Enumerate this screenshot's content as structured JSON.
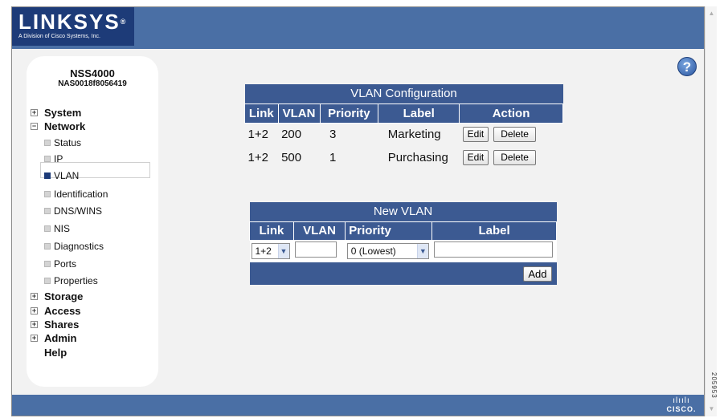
{
  "brand": {
    "name": "LINKSYS",
    "registered": "®",
    "tagline": "A Division of Cisco Systems, Inc.",
    "footer_logo": "CISCO."
  },
  "help_button": "?",
  "device": {
    "model": "NSS4000",
    "id": "NAS0018f8056419"
  },
  "sidebar": {
    "items": [
      {
        "label": "System",
        "type": "section",
        "toggle": "+"
      },
      {
        "label": "Network",
        "type": "section",
        "toggle": "−"
      },
      {
        "label": "Status",
        "type": "sub"
      },
      {
        "label": "IP",
        "type": "sub"
      },
      {
        "label": "VLAN",
        "type": "sub",
        "selected": true
      },
      {
        "label": "Identification",
        "type": "sub"
      },
      {
        "label": "DNS/WINS",
        "type": "sub"
      },
      {
        "label": "NIS",
        "type": "sub"
      },
      {
        "label": "Diagnostics",
        "type": "sub"
      },
      {
        "label": "Ports",
        "type": "sub"
      },
      {
        "label": "Properties",
        "type": "sub"
      },
      {
        "label": "Storage",
        "type": "section",
        "toggle": "+"
      },
      {
        "label": "Access",
        "type": "section",
        "toggle": "+"
      },
      {
        "label": "Shares",
        "type": "section",
        "toggle": "+"
      },
      {
        "label": "Admin",
        "type": "section",
        "toggle": "+"
      },
      {
        "label": "Help",
        "type": "section"
      }
    ]
  },
  "vlan_config": {
    "title": "VLAN Configuration",
    "headers": [
      "Link",
      "VLAN",
      "Priority",
      "Label",
      "Action"
    ],
    "rows": [
      {
        "link": "1+2",
        "vlan": "200",
        "priority": "3",
        "label": "Marketing"
      },
      {
        "link": "1+2",
        "vlan": "500",
        "priority": "1",
        "label": "Purchasing"
      }
    ],
    "edit_label": "Edit",
    "delete_label": "Delete"
  },
  "new_vlan": {
    "title": "New VLAN",
    "headers": [
      "Link",
      "VLAN",
      "Priority",
      "Label"
    ],
    "link_value": "1+2",
    "vlan_value": "",
    "priority_value": "0 (Lowest)",
    "label_value": "",
    "add_label": "Add"
  },
  "side_code": "205953",
  "colors": {
    "header_blue": "#4a6fa5",
    "logo_navy": "#1d3b78",
    "table_blue": "#3c5a92"
  }
}
